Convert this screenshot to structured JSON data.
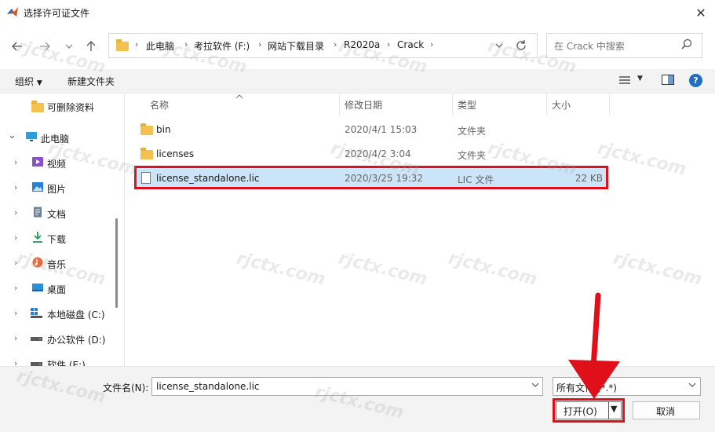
{
  "window": {
    "title": "选择许可证文件",
    "close_label": "✕"
  },
  "nav": {
    "back_icon": "arrow-left-icon",
    "forward_icon": "arrow-right-icon",
    "recent_icon": "chevron-down-icon",
    "up_icon": "arrow-up-icon",
    "breadcrumb": [
      "此电脑",
      "考拉软件 (F:)",
      "网站下载目录",
      "R2020a",
      "Crack"
    ],
    "refresh_icon": "refresh-icon",
    "search_placeholder": "在 Crack 中搜索"
  },
  "toolbar": {
    "organize": "组织",
    "new_folder": "新建文件夹"
  },
  "sidebar": {
    "items": [
      {
        "label": "可删除资料",
        "icon": "folder-icon",
        "chevron": ""
      },
      {
        "label": "此电脑",
        "icon": "computer-icon",
        "chevron": "⌄"
      },
      {
        "label": "视频",
        "icon": "video-icon",
        "chevron": "›"
      },
      {
        "label": "图片",
        "icon": "pictures-icon",
        "chevron": "›"
      },
      {
        "label": "文档",
        "icon": "documents-icon",
        "chevron": "›"
      },
      {
        "label": "下载",
        "icon": "download-icon",
        "chevron": "›"
      },
      {
        "label": "音乐",
        "icon": "music-icon",
        "chevron": "›"
      },
      {
        "label": "桌面",
        "icon": "desktop-icon",
        "chevron": "›"
      },
      {
        "label": "本地磁盘 (C:)",
        "icon": "drive-c-icon",
        "chevron": "›"
      },
      {
        "label": "办公软件 (D:)",
        "icon": "drive-icon",
        "chevron": "›"
      },
      {
        "label": "软件 (E:)",
        "icon": "drive-icon",
        "chevron": "›"
      }
    ]
  },
  "columns": {
    "name": "名称",
    "modified": "修改日期",
    "type": "类型",
    "size": "大小"
  },
  "files": [
    {
      "name": "bin",
      "modified": "2020/4/1 15:03",
      "type": "文件夹",
      "size": "",
      "kind": "folder"
    },
    {
      "name": "licenses",
      "modified": "2020/4/2 3:04",
      "type": "文件夹",
      "size": "",
      "kind": "folder"
    },
    {
      "name": "license_standalone.lic",
      "modified": "2020/3/25 19:32",
      "type": "LIC 文件",
      "size": "22 KB",
      "kind": "file"
    }
  ],
  "bottom": {
    "filename_label": "文件名(N):",
    "filename_value": "license_standalone.lic",
    "filetype_value": "所有文件 (*.*)",
    "open_label": "打开(O)",
    "cancel_label": "取消"
  },
  "watermark": "rjctx.com",
  "colors": {
    "highlight_red": "#e0101b",
    "selection_blue": "#cce4f7",
    "help_blue": "#1f6fc5",
    "folder_yellow": "#f2c14e"
  }
}
